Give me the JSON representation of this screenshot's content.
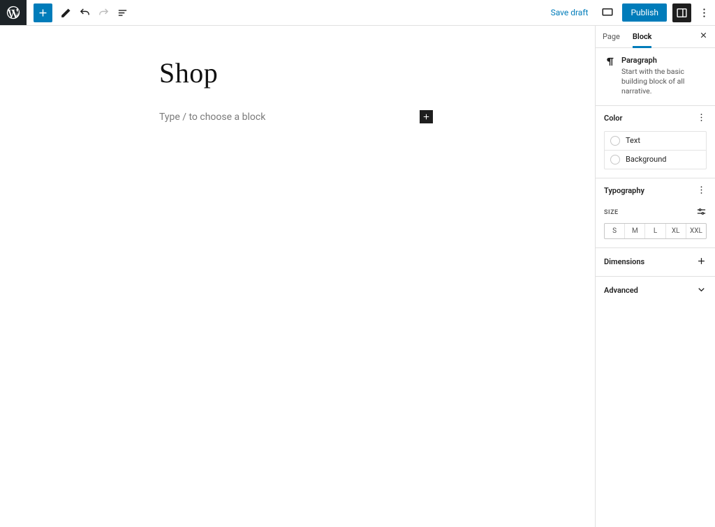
{
  "toolbar": {
    "save_draft": "Save draft",
    "publish": "Publish"
  },
  "editor": {
    "title": "Shop",
    "paragraph_placeholder": "Type / to choose a block"
  },
  "sidebar": {
    "tabs": {
      "page": "Page",
      "block": "Block",
      "active": "block"
    },
    "block_card": {
      "name": "Paragraph",
      "description": "Start with the basic building block of all narrative."
    },
    "panels": {
      "color": {
        "title": "Color",
        "items": {
          "text": "Text",
          "background": "Background"
        }
      },
      "typography": {
        "title": "Typography",
        "size_label": "SIZE",
        "sizes": [
          "S",
          "M",
          "L",
          "XL",
          "XXL"
        ]
      },
      "dimensions": {
        "title": "Dimensions"
      },
      "advanced": {
        "title": "Advanced"
      }
    }
  }
}
